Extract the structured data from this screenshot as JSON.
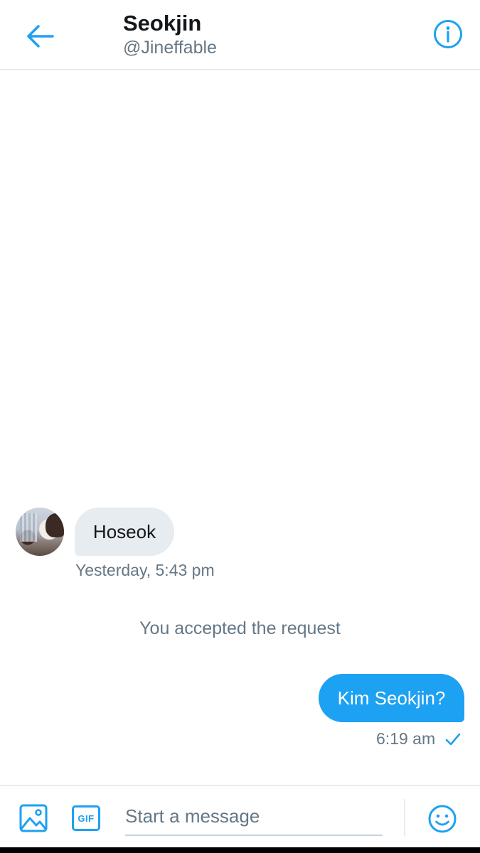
{
  "header": {
    "back_icon": "arrow-left-icon",
    "title": "Seokjin",
    "handle": "@Jineffable",
    "info_icon": "info-icon"
  },
  "messages": {
    "incoming": {
      "text": "Hoseok",
      "timestamp": "Yesterday, 5:43 pm",
      "avatar": "avatar-photo"
    },
    "system_notice": "You accepted the request",
    "outgoing": {
      "text": "Kim Seokjin?",
      "timestamp": "6:19 am",
      "status_icon": "checkmark-icon"
    }
  },
  "composer": {
    "image_icon": "image-icon",
    "gif_label": "GIF",
    "placeholder": "Start a message",
    "emoji_icon": "emoji-icon"
  },
  "colors": {
    "accent": "#1da1f2",
    "incoming_bubble": "#e6ecf0",
    "secondary_text": "#657786",
    "primary_text": "#14171a"
  }
}
